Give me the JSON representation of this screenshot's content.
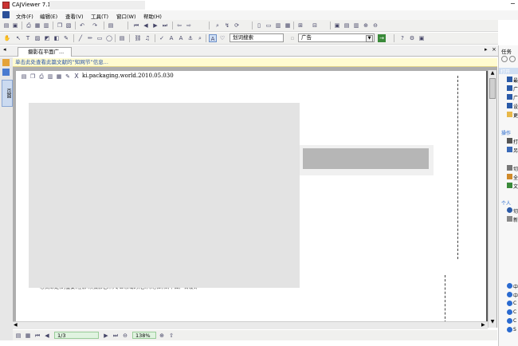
{
  "window": {
    "title": "CAJViewer 7.1",
    "minimize_glyph": "−"
  },
  "menu": {
    "items": [
      "文件(F)",
      "编辑(E)",
      "查看(V)",
      "工具(T)",
      "窗口(W)",
      "帮助(H)"
    ]
  },
  "toolbar3": {
    "font_combo": "划词搜索",
    "search_combo": "广告"
  },
  "tabs": [
    {
      "label": "摄影在平面广..."
    }
  ],
  "notification": {
    "text": "单击此处查看此篇文献的“知网节”信息..."
  },
  "document": {
    "float_toolbar_text": "ki.packaging.world.2010.05.030",
    "close_glyph": "X",
    "bottom_text": "心灵深处(的重要)在影响(摄影艺术)专业领域的(艺术)地位(和)平面广告设计"
  },
  "statusbar": {
    "page": "1/3",
    "zoom": "138%"
  },
  "taskpane": {
    "header": "任务",
    "section_open": "打开",
    "section_ops": "操作",
    "section_personal": "个人",
    "items_open": [
      "最",
      "广",
      "广",
      "设",
      "更"
    ],
    "items_ops": [
      "打",
      "另"
    ],
    "items_mid": [
      "切",
      "全",
      "文"
    ],
    "items_personal": [
      "切",
      "新"
    ],
    "items_bottom": [
      "中",
      "中",
      "C",
      "C",
      "C",
      "S"
    ]
  },
  "left_rail": {
    "label": "页面"
  },
  "colors": {
    "notify_text": "#2b55a8",
    "notify_bg": "#fffbd0",
    "accent": "#2266cc"
  }
}
